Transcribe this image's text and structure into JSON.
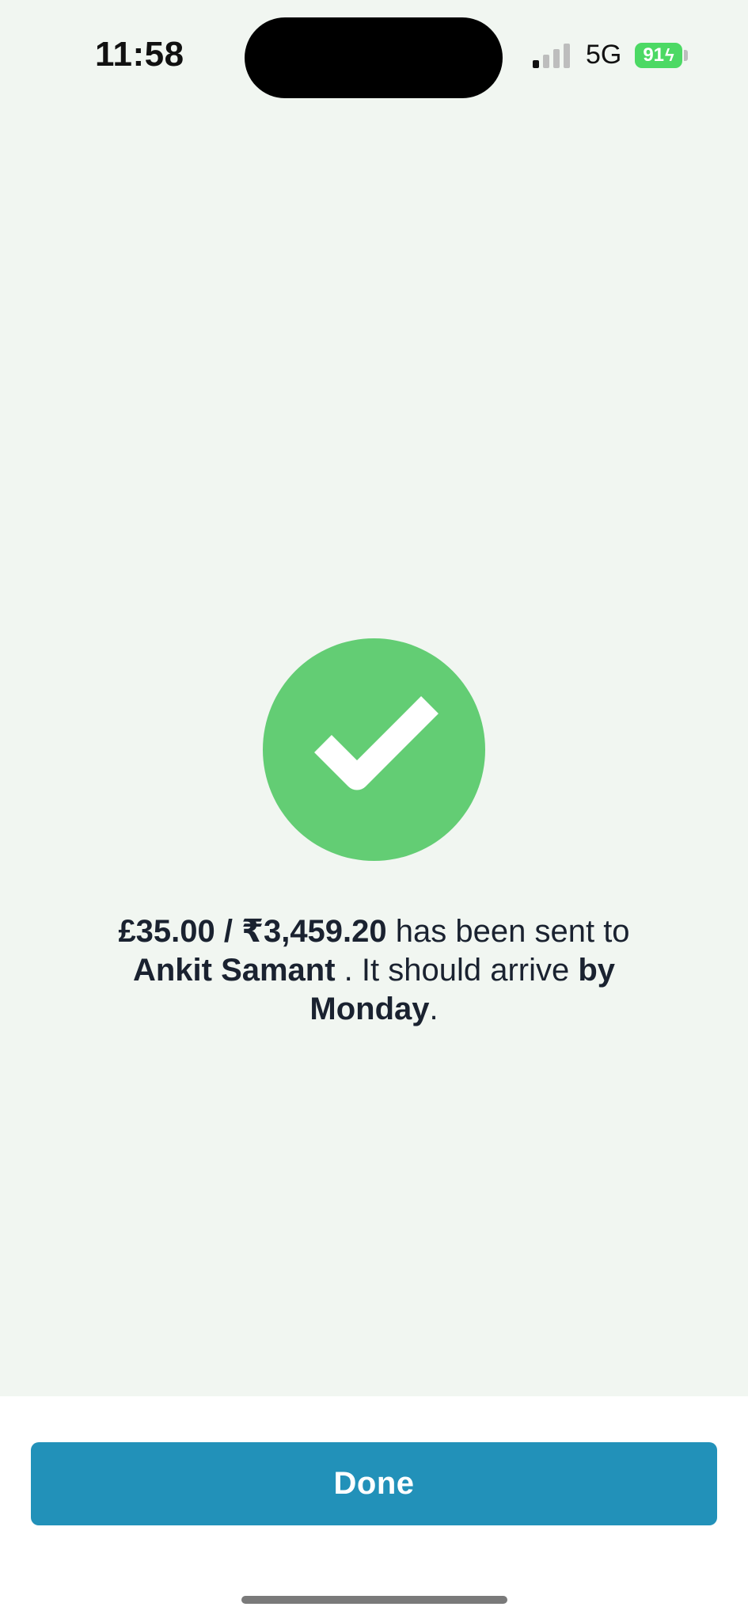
{
  "status_bar": {
    "time": "11:58",
    "network": "5G",
    "battery_level": "91",
    "battery_charging_symbol": "ϟ",
    "signal_bars_active": 1,
    "signal_bars_total": 4
  },
  "success": {
    "icon": "checkmark-icon",
    "icon_color": "#63cd74",
    "amount": "£35.00 / ₹3,459.20",
    "text_sent": " has been sent to",
    "recipient": "Ankit Samant",
    "text_arrive": " . It should arrive ",
    "arrival": "by Monday",
    "period": "."
  },
  "actions": {
    "done_label": "Done",
    "done_color": "#2291b9"
  },
  "colors": {
    "background": "#f1f6f1",
    "text": "#1a2230"
  }
}
